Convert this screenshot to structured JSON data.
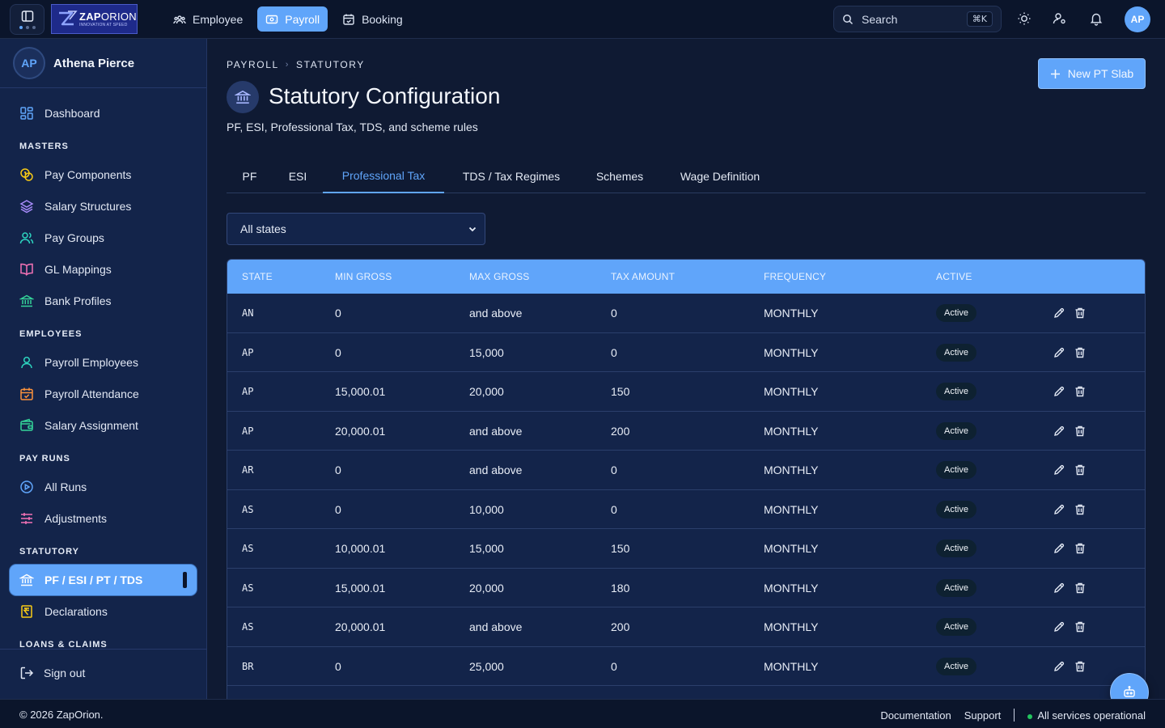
{
  "app": {
    "logo": {
      "name_bold": "ZAP",
      "name_light": "ORION",
      "tagline": "INNOVATION AT SPEED"
    },
    "nav": [
      {
        "label": "Employee",
        "icon": "users-icon",
        "active": false
      },
      {
        "label": "Payroll",
        "icon": "wallet-icon",
        "active": true
      },
      {
        "label": "Booking",
        "icon": "calendar-icon",
        "active": false
      }
    ],
    "search": {
      "placeholder": "Search",
      "shortcut": "⌘K"
    },
    "user_initials": "AP"
  },
  "sidebar": {
    "user": {
      "initials": "AP",
      "name": "Athena Pierce"
    },
    "items": [
      {
        "type": "item",
        "label": "Dashboard",
        "icon": "dashboard-icon",
        "color": "#60a5fa"
      },
      {
        "type": "section",
        "label": "MASTERS"
      },
      {
        "type": "item",
        "label": "Pay Components",
        "icon": "coins-icon",
        "color": "#facc15"
      },
      {
        "type": "item",
        "label": "Salary Structures",
        "icon": "layers-icon",
        "color": "#a78bfa"
      },
      {
        "type": "item",
        "label": "Pay Groups",
        "icon": "users-icon",
        "color": "#2dd4bf"
      },
      {
        "type": "item",
        "label": "GL Mappings",
        "icon": "book-icon",
        "color": "#f472b6"
      },
      {
        "type": "item",
        "label": "Bank Profiles",
        "icon": "bank-icon",
        "color": "#34d399"
      },
      {
        "type": "section",
        "label": "EMPLOYEES"
      },
      {
        "type": "item",
        "label": "Payroll Employees",
        "icon": "user-icon",
        "color": "#2dd4bf"
      },
      {
        "type": "item",
        "label": "Payroll Attendance",
        "icon": "calendar-check-icon",
        "color": "#fb923c"
      },
      {
        "type": "item",
        "label": "Salary Assignment",
        "icon": "wallet-card-icon",
        "color": "#34d399"
      },
      {
        "type": "section",
        "label": "PAY RUNS"
      },
      {
        "type": "item",
        "label": "All Runs",
        "icon": "play-circle-icon",
        "color": "#60a5fa"
      },
      {
        "type": "item",
        "label": "Adjustments",
        "icon": "sliders-icon",
        "color": "#f472b6"
      },
      {
        "type": "section",
        "label": "STATUTORY"
      },
      {
        "type": "item",
        "label": "PF / ESI / PT / TDS",
        "icon": "bank-icon",
        "color": "#ffffff",
        "active": true
      },
      {
        "type": "item",
        "label": "Declarations",
        "icon": "receipt-rupee-icon",
        "color": "#facc15"
      },
      {
        "type": "section",
        "label": "LOANS & CLAIMS"
      }
    ],
    "signout_label": "Sign out"
  },
  "page": {
    "breadcrumb": [
      "PAYROLL",
      "STATUTORY"
    ],
    "title": "Statutory Configuration",
    "subtitle": "PF, ESI, Professional Tax, TDS, and scheme rules",
    "primary_action": "New PT Slab",
    "tabs": [
      {
        "label": "PF",
        "active": false
      },
      {
        "label": "ESI",
        "active": false
      },
      {
        "label": "Professional Tax",
        "active": true
      },
      {
        "label": "TDS / Tax Regimes",
        "active": false
      },
      {
        "label": "Schemes",
        "active": false
      },
      {
        "label": "Wage Definition",
        "active": false
      }
    ],
    "state_filter": {
      "value": "All states"
    }
  },
  "table": {
    "columns": [
      "STATE",
      "MIN GROSS",
      "MAX GROSS",
      "TAX AMOUNT",
      "FREQUENCY",
      "ACTIVE"
    ],
    "rows": [
      {
        "state": "AN",
        "min": "0",
        "max": "and above",
        "tax": "0",
        "freq": "MONTHLY",
        "status": "Active"
      },
      {
        "state": "AP",
        "min": "0",
        "max": "15,000",
        "tax": "0",
        "freq": "MONTHLY",
        "status": "Active"
      },
      {
        "state": "AP",
        "min": "15,000.01",
        "max": "20,000",
        "tax": "150",
        "freq": "MONTHLY",
        "status": "Active"
      },
      {
        "state": "AP",
        "min": "20,000.01",
        "max": "and above",
        "tax": "200",
        "freq": "MONTHLY",
        "status": "Active"
      },
      {
        "state": "AR",
        "min": "0",
        "max": "and above",
        "tax": "0",
        "freq": "MONTHLY",
        "status": "Active"
      },
      {
        "state": "AS",
        "min": "0",
        "max": "10,000",
        "tax": "0",
        "freq": "MONTHLY",
        "status": "Active"
      },
      {
        "state": "AS",
        "min": "10,000.01",
        "max": "15,000",
        "tax": "150",
        "freq": "MONTHLY",
        "status": "Active"
      },
      {
        "state": "AS",
        "min": "15,000.01",
        "max": "20,000",
        "tax": "180",
        "freq": "MONTHLY",
        "status": "Active"
      },
      {
        "state": "AS",
        "min": "20,000.01",
        "max": "and above",
        "tax": "200",
        "freq": "MONTHLY",
        "status": "Active"
      },
      {
        "state": "BR",
        "min": "0",
        "max": "25,000",
        "tax": "0",
        "freq": "MONTHLY",
        "status": "Active"
      }
    ]
  },
  "footer": {
    "copyright": "© 2026 ZapOrion.",
    "links": [
      "Documentation",
      "Support"
    ],
    "status": "All services operational"
  },
  "colors": {
    "accent": "#60a5fa",
    "background": "#0f1a33",
    "sidebar": "#13244a",
    "success": "#22c55e"
  }
}
